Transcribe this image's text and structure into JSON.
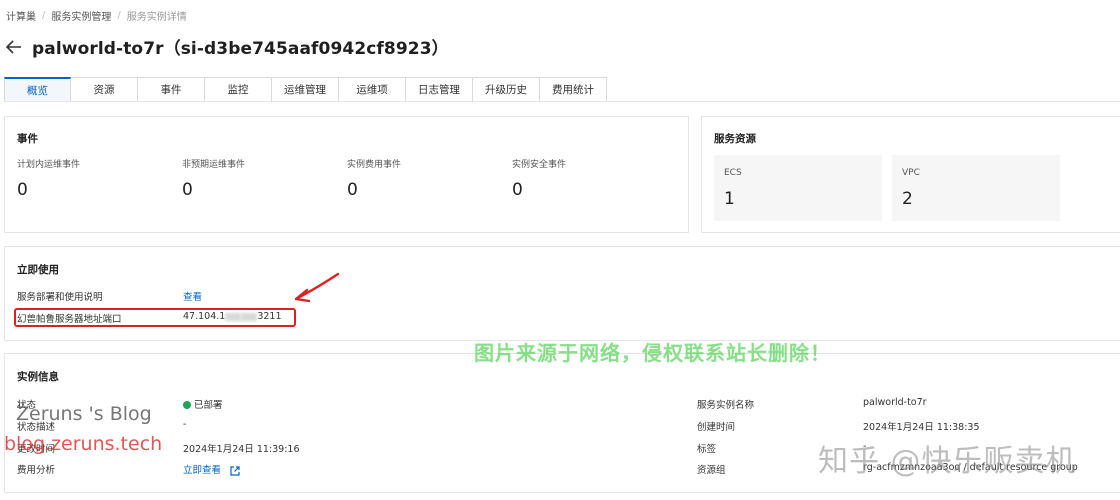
{
  "breadcrumb": [
    "计算巢",
    "服务实例管理",
    "服务实例详情"
  ],
  "page_title": "palworld-to7r（si-d3be745aaf0942cf8923）",
  "tabs": [
    "概览",
    "资源",
    "事件",
    "监控",
    "运维管理",
    "运维项",
    "日志管理",
    "升级历史",
    "费用统计"
  ],
  "active_tab": "概览",
  "events": {
    "title": "事件",
    "stats": [
      {
        "label": "计划内运维事件",
        "value": "0"
      },
      {
        "label": "非预期运维事件",
        "value": "0"
      },
      {
        "label": "实例费用事件",
        "value": "0"
      },
      {
        "label": "实例安全事件",
        "value": "0"
      }
    ]
  },
  "resources": {
    "title": "服务资源",
    "items": [
      {
        "label": "ECS",
        "value": "1"
      },
      {
        "label": "VPC",
        "value": "2"
      }
    ]
  },
  "usage": {
    "title": "立即使用",
    "rows": [
      {
        "label": "服务部署和使用说明",
        "value": "查看"
      },
      {
        "label": "幻兽帕鲁服务器地址端口",
        "value_prefix": "47.104.1",
        "value_suffix": "3211"
      }
    ]
  },
  "instance_info": {
    "title": "实例信息",
    "left": [
      {
        "label": "状态",
        "value": "已部署"
      },
      {
        "label": "状态描述",
        "value": "-"
      },
      {
        "label": "更改时间",
        "value": "2024年1月24日 11:39:16"
      },
      {
        "label": "费用分析",
        "value": "立即查看"
      }
    ],
    "right": [
      {
        "label": "服务实例名称",
        "value": "palworld-to7r"
      },
      {
        "label": "创建时间",
        "value": "2024年1月24日 11:38:35"
      },
      {
        "label": "标签",
        "value": "-"
      },
      {
        "label": "资源组",
        "value": "rg-acfmzmnzoaa3oq / default resource group"
      }
    ]
  },
  "watermarks": {
    "notice": "图片来源于网络，侵权联系站长删除！",
    "blog": "Zeruns 's Blog",
    "url": "blog.zeruns.tech",
    "zhihu": "知乎 @快乐贩卖机"
  },
  "colors": {
    "accent": "#0064c8",
    "status_ok": "#1ea653",
    "highlight": "#e02020"
  }
}
